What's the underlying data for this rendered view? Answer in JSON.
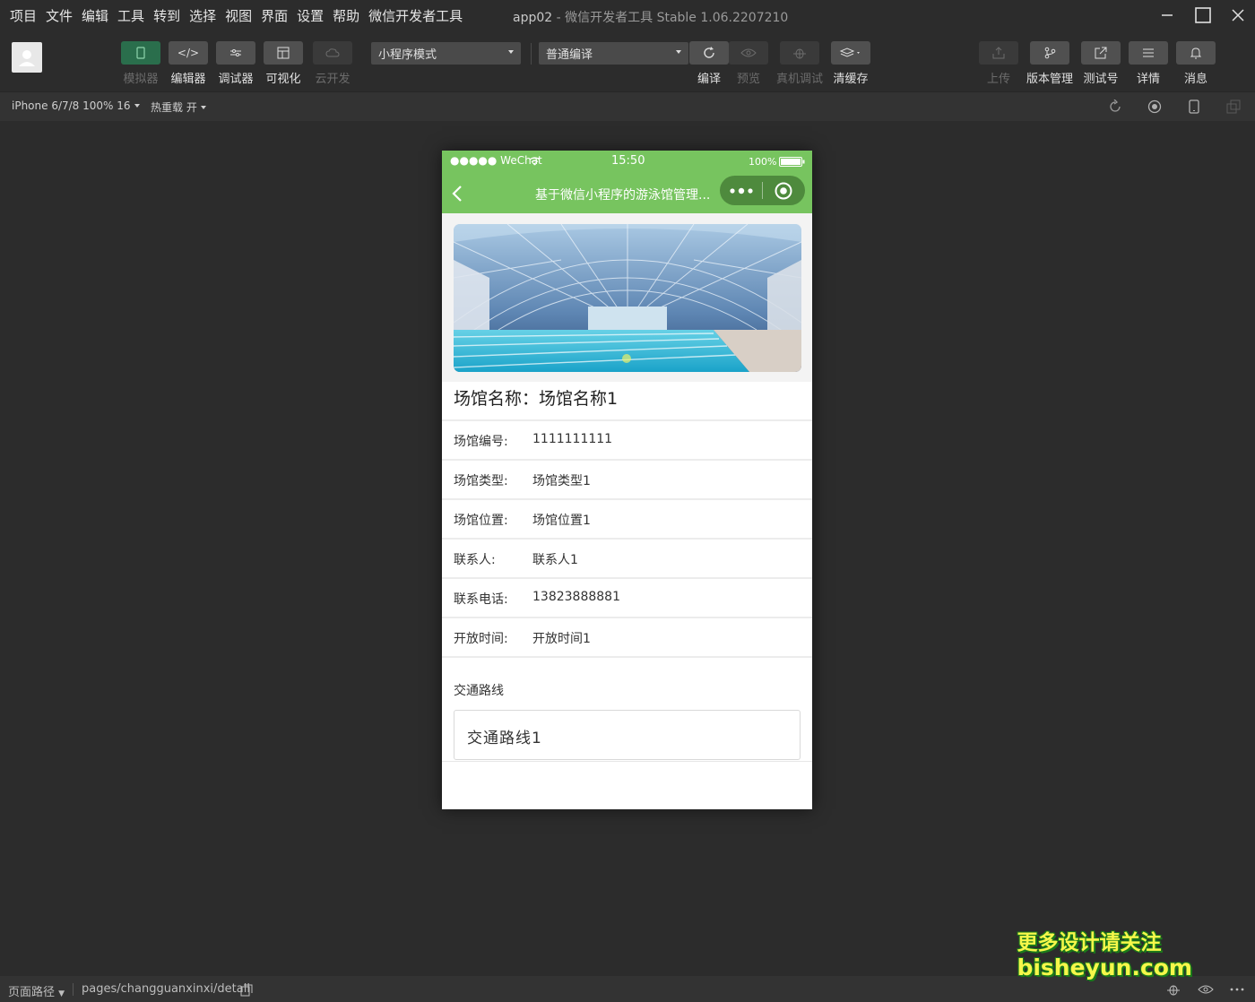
{
  "menubar": {
    "items": [
      "项目",
      "文件",
      "编辑",
      "工具",
      "转到",
      "选择",
      "视图",
      "界面",
      "设置",
      "帮助",
      "微信开发者工具"
    ],
    "window_title_app": "app02",
    "window_title_rest": " - 微信开发者工具 Stable 1.06.2207210"
  },
  "toolbar": {
    "simulator_label": "模拟器",
    "editor_label": "编辑器",
    "debugger_label": "调试器",
    "visual_label": "可视化",
    "cloud_label": "云开发",
    "mode_select": "小程序模式",
    "compile_select": "普通编译",
    "compile_label": "编译",
    "preview_label": "预览",
    "remote_debug_label": "真机调试",
    "clear_cache_label": "清缓存",
    "upload_label": "上传",
    "version_label": "版本管理",
    "test_account_label": "测试号",
    "details_label": "详情",
    "messages_label": "消息"
  },
  "subbar": {
    "device": "iPhone 6/7/8 100% 16",
    "hot_reload": "热重载 开"
  },
  "phone": {
    "status": {
      "carrier": "●●●●● WeChat",
      "time": "15:50",
      "battery": "100%"
    },
    "nav_title": "基于微信小程序的游泳馆管理...",
    "venue_title": "场馆名称：场馆名称1",
    "fields": [
      {
        "label": "场馆编号:",
        "value": "1111111111"
      },
      {
        "label": "场馆类型:",
        "value": "场馆类型1"
      },
      {
        "label": "场馆位置:",
        "value": "场馆位置1"
      },
      {
        "label": "联系人:",
        "value": "联系人1"
      },
      {
        "label": "联系电话:",
        "value": "13823888881"
      },
      {
        "label": "开放时间:",
        "value": "开放时间1"
      }
    ],
    "route_label": "交通路线",
    "route_value": "交通路线1"
  },
  "bottombar": {
    "page_path_label": "页面路径",
    "page_path": "pages/changguanxinxi/detail"
  },
  "watermark": {
    "line1": "更多设计请关注",
    "line2": "bisheyun.com"
  },
  "colors": {
    "wechat_green": "#77c45f",
    "ide_bg": "#2c2c2c",
    "simulator_btn_active": "#2a6e4c"
  }
}
